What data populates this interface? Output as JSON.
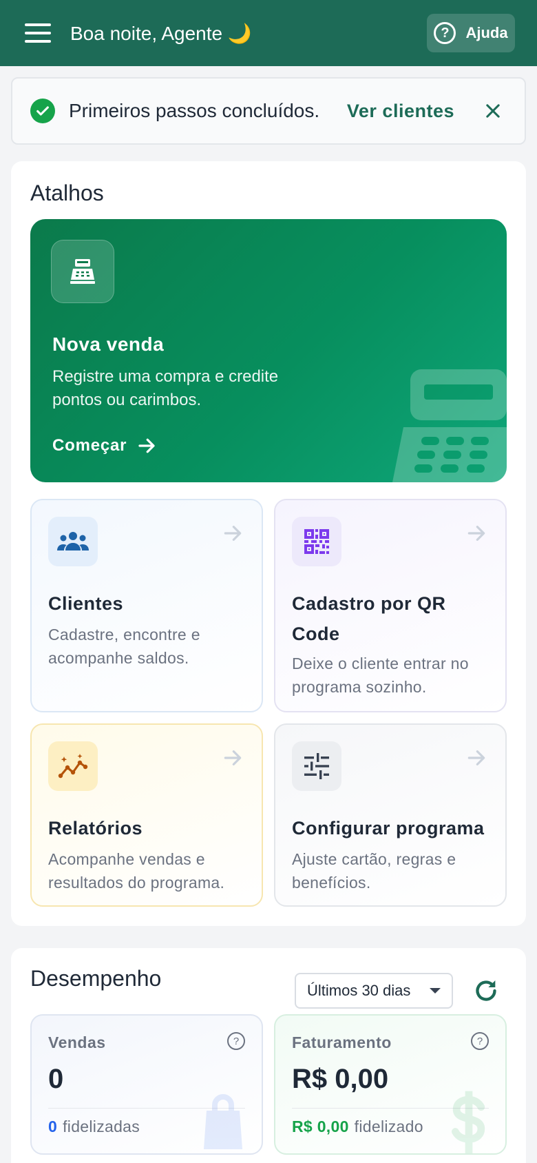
{
  "header": {
    "greeting": "Boa noite, Agente 🌙",
    "help_label": "Ajuda",
    "help_glyph": "?",
    "background": "#1d6b57"
  },
  "banner": {
    "message": "Primeiros passos concluídos.",
    "link_label": "Ver clientes"
  },
  "shortcuts": {
    "title": "Atalhos",
    "hero": {
      "title": "Nova venda",
      "description": "Registre uma compra e credite pontos ou carimbos.",
      "cta": "Começar",
      "icon": "cash-register-icon"
    },
    "cards": [
      {
        "title": "Clientes",
        "description": "Cadastre, encontre e acompanhe saldos.",
        "icon": "people-group-icon"
      },
      {
        "title": "Cadastro por QR Code",
        "description": "Deixe o cliente entrar no programa sozinho.",
        "icon": "qr-code-icon"
      },
      {
        "title": "Relatórios",
        "description": "Acompanhe vendas e resultados do programa.",
        "icon": "insights-chart-icon"
      },
      {
        "title": "Configurar programa",
        "description": "Ajuste cartão, regras e benefícios.",
        "icon": "sliders-icon"
      }
    ]
  },
  "performance": {
    "title": "Desempenho",
    "period": "Últimos 30 dias",
    "metrics": [
      {
        "label": "Vendas",
        "value": "0",
        "sub_value": "0",
        "sub_label": "fidelizadas",
        "help_glyph": "?"
      },
      {
        "label": "Faturamento",
        "value": "R$ 0,00",
        "sub_value": "R$ 0,00",
        "sub_label": "fidelizado",
        "help_glyph": "?"
      }
    ]
  },
  "colors": {
    "brand": "#1d6b57",
    "hero_green": "#078f5e",
    "success": "#16a34a",
    "blue": "#2563eb",
    "purple": "#7c3aed",
    "amber": "#b45309"
  }
}
